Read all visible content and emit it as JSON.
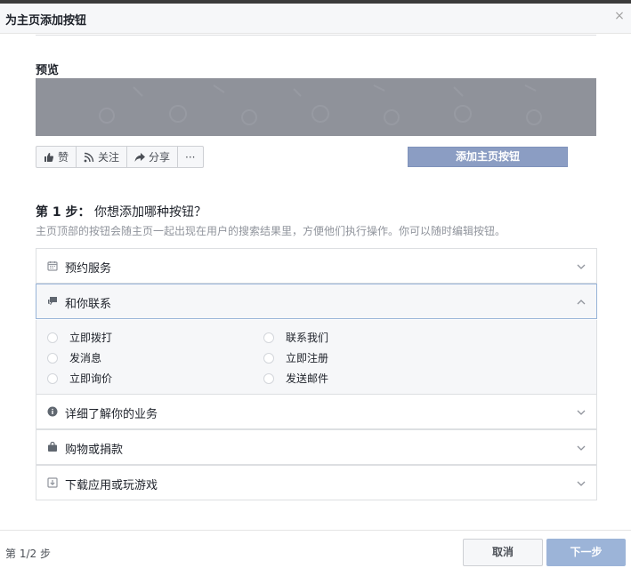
{
  "dialog": {
    "title": "为主页添加按钮",
    "close_symbol": "×"
  },
  "preview": {
    "label": "预览",
    "actions": [
      {
        "icon": "thumbs-up-icon",
        "label": "赞"
      },
      {
        "icon": "rss-icon",
        "label": "关注"
      },
      {
        "icon": "share-arrow-icon",
        "label": "分享"
      },
      {
        "icon": "more-icon",
        "label": "···"
      }
    ],
    "add_button": "添加主页按钮"
  },
  "step": {
    "number": "第 1 步：",
    "question": "你想添加哪种按钮？",
    "subtitle": "主页顶部的按钮会随主页一起出现在用户的搜索结果里，方便他们执行操作。你可以随时编辑按钮。"
  },
  "categories": [
    {
      "icon": "calendar-icon",
      "label": "预约服务",
      "expanded": false
    },
    {
      "icon": "chat-icon",
      "label": "和你联系",
      "expanded": true
    },
    {
      "icon": "info-icon",
      "label": "详细了解你的业务",
      "expanded": false
    },
    {
      "icon": "shopping-bag-icon",
      "label": "购物或捐款",
      "expanded": false
    },
    {
      "icon": "download-icon",
      "label": "下载应用或玩游戏",
      "expanded": false
    }
  ],
  "contact_options": {
    "left": [
      "立即拨打",
      "发消息",
      "立即询价"
    ],
    "right": [
      "联系我们",
      "立即注册",
      "发送邮件"
    ]
  },
  "footer": {
    "step_count": "第 1/2 步",
    "cancel": "取消",
    "next": "下一步"
  },
  "colors": {
    "primary_disabled": "#9cb4d8",
    "add_button": "#8b9dc3",
    "active_border": "#98b4d8"
  }
}
